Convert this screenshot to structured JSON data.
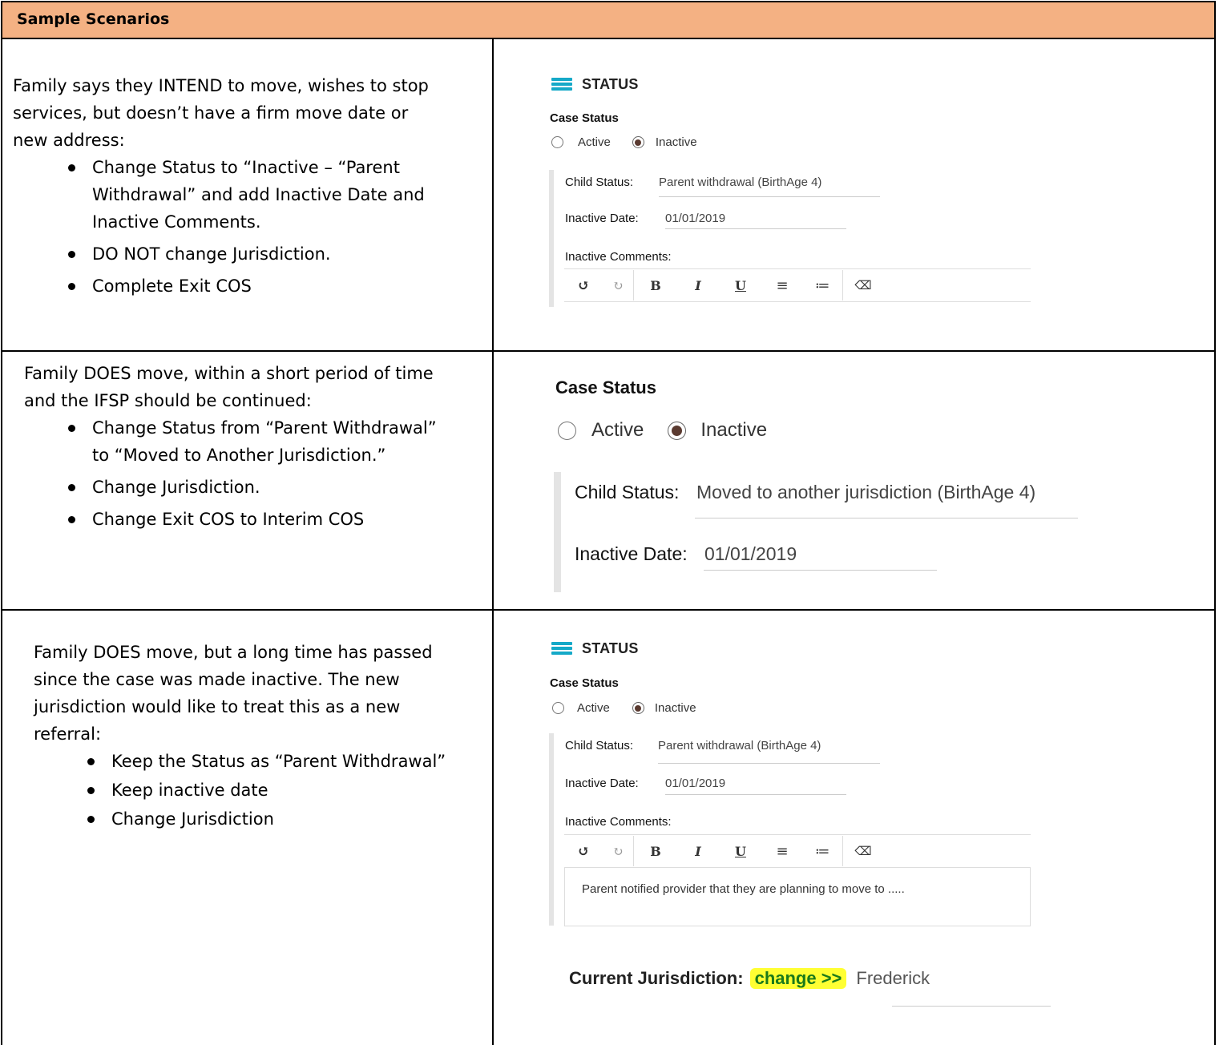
{
  "header": {
    "title": "Sample Scenarios"
  },
  "rows": [
    {
      "intro": "Family says they INTEND to move, wishes to stop services, but doesn’t have a firm move date or new address:",
      "bullets": [
        "Change Status to “Inactive – “Parent Withdrawal” and add Inactive Date and Inactive Comments.",
        "DO NOT change Jurisdiction.",
        "Complete Exit COS"
      ]
    },
    {
      "intro": "Family DOES move, within a short period of time and the IFSP should be continued:",
      "bullets": [
        "Change Status from “Parent Withdrawal” to “Moved to Another Jurisdiction.”",
        "Change Jurisdiction.",
        "Change Exit COS to Interim COS"
      ]
    },
    {
      "intro": "Family DOES move, but a long time has passed since the case was made inactive.  The new jurisdiction would like to treat this as a new referral:",
      "bullets": [
        "Keep the Status as “Parent Withdrawal”",
        "Keep inactive date",
        "Change Jurisdiction"
      ]
    }
  ],
  "ui1": {
    "section_title": "STATUS",
    "case_status_label": "Case Status",
    "radio_active": "Active",
    "radio_inactive": "Inactive",
    "selected": "Inactive",
    "child_status_label": "Child Status:",
    "child_status_value": "Parent withdrawal (BirthAge 4)",
    "inactive_date_label": "Inactive Date:",
    "inactive_date_value": "01/01/2019",
    "inactive_comments_label": "Inactive Comments:"
  },
  "ui2": {
    "case_status_label": "Case Status",
    "radio_active": "Active",
    "radio_inactive": "Inactive",
    "selected": "Inactive",
    "child_status_label": "Child Status:",
    "child_status_value": "Moved to another jurisdiction (BirthAge 4)",
    "inactive_date_label": "Inactive Date:",
    "inactive_date_value": "01/01/2019"
  },
  "ui3": {
    "section_title": "STATUS",
    "case_status_label": "Case Status",
    "radio_active": "Active",
    "radio_inactive": "Inactive",
    "selected": "Inactive",
    "child_status_label": "Child Status:",
    "child_status_value": "Parent withdrawal (BirthAge 4)",
    "inactive_date_label": "Inactive Date:",
    "inactive_date_value": "01/01/2019",
    "inactive_comments_label": "Inactive Comments:",
    "comments_text": "Parent notified provider that they are planning to move to .....",
    "current_jurisdiction_label": "Current Jurisdiction:",
    "change_link": "change >>",
    "jurisdiction_value": "Frederick"
  },
  "toolbar": {
    "undo": "↺",
    "redo": "↻",
    "bold": "B",
    "italic": "I",
    "underline": "U",
    "ordered_list": "≡",
    "bullet_list": "≔",
    "eraser": "⌫"
  },
  "colors": {
    "header_bg": "#f4b183",
    "status_icon": "#15a9c8",
    "highlight": "#ffff33",
    "link": "#1a7a1a"
  }
}
